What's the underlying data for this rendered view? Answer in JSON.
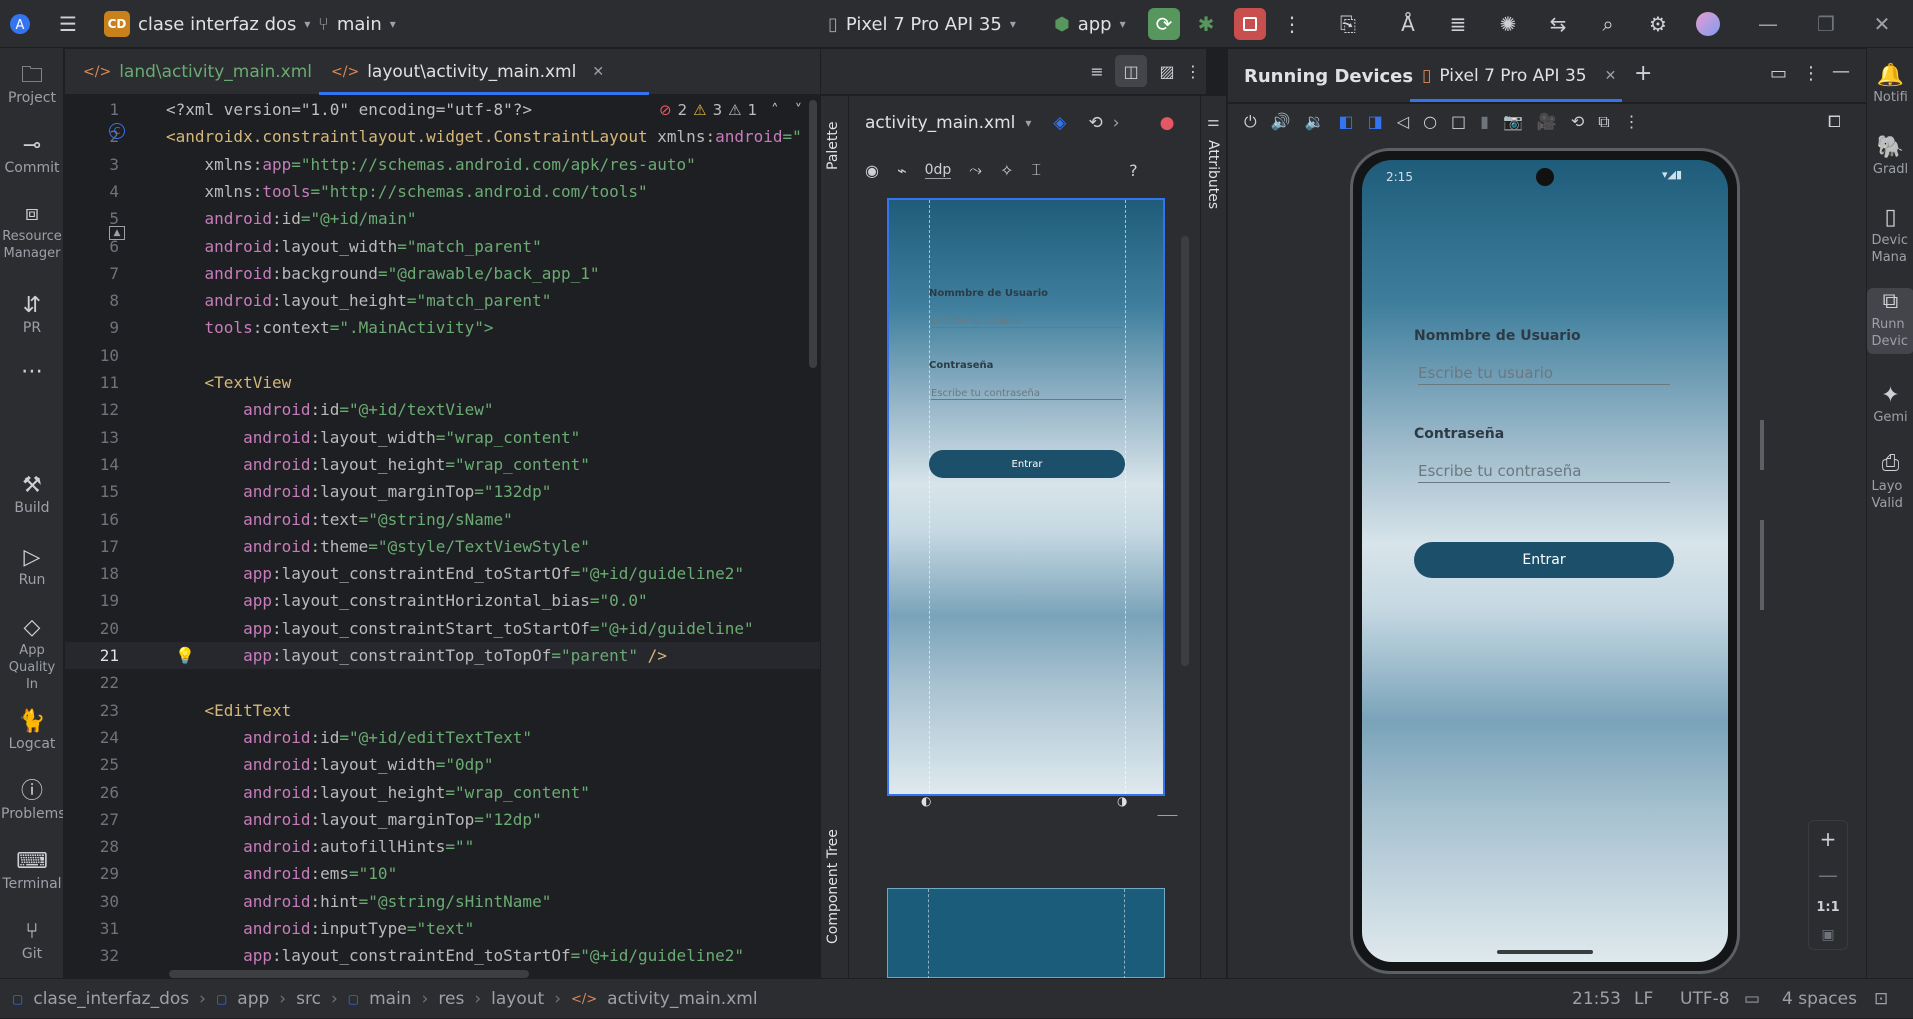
{
  "titlebar": {
    "project_badge": "CD",
    "project_name": "clase interfaz dos",
    "branch": "main",
    "device": "Pixel 7 Pro API 35",
    "run_config": "app"
  },
  "left_tools": [
    {
      "label": "Project",
      "icon": "folder-icon"
    },
    {
      "label": "Commit",
      "icon": "commit-icon"
    },
    {
      "label": "Resource Manager",
      "icon": "resource-manager-icon"
    },
    {
      "label": "PR",
      "icon": "pull-request-icon"
    },
    {
      "label": "Build",
      "icon": "hammer-icon"
    },
    {
      "label": "Run",
      "icon": "run-icon"
    },
    {
      "label": "App Quality In",
      "icon": "app-quality-icon"
    },
    {
      "label": "Logcat",
      "icon": "logcat-icon"
    },
    {
      "label": "Problems",
      "icon": "problems-icon"
    },
    {
      "label": "Terminal",
      "icon": "terminal-icon"
    },
    {
      "label": "Git",
      "icon": "git-icon"
    }
  ],
  "right_tools": [
    {
      "label": "Notifi",
      "icon": "bell-icon"
    },
    {
      "label": "Gradl",
      "icon": "gradle-icon"
    },
    {
      "label": "Devic Mana",
      "icon": "device-manager-icon"
    },
    {
      "label": "Runn Devic",
      "icon": "running-devices-icon"
    },
    {
      "label": "Gemi",
      "icon": "gemini-icon"
    },
    {
      "label": "Layo Valid",
      "icon": "layout-validation-icon"
    }
  ],
  "editor_tabs": [
    {
      "label": "land\\activity_main.xml",
      "active": false
    },
    {
      "label": "layout\\activity_main.xml",
      "active": true
    }
  ],
  "inspection": {
    "errors": "2",
    "warnings": "3",
    "weak": "1"
  },
  "code_lines": [
    {
      "n": "1",
      "segments": [
        {
          "t": "<?xml version=\"1.0\" encoding=\"utf-8\"?>",
          "c": "pi"
        }
      ]
    },
    {
      "n": "2",
      "segments": [
        {
          "t": "<androidx.constraintlayout.widget.ConstraintLayout ",
          "c": "tag"
        },
        {
          "t": "xmlns:",
          "c": "attr"
        },
        {
          "t": "android",
          "c": "attrns"
        },
        {
          "t": "=\"",
          "c": "val"
        }
      ]
    },
    {
      "n": "3",
      "segments": [
        {
          "t": "    xmlns:",
          "c": "attr"
        },
        {
          "t": "app",
          "c": "attrns"
        },
        {
          "t": "=\"http://schemas.android.com/apk/res-auto\"",
          "c": "val"
        }
      ]
    },
    {
      "n": "4",
      "segments": [
        {
          "t": "    xmlns:",
          "c": "attr"
        },
        {
          "t": "tools",
          "c": "attrns"
        },
        {
          "t": "=\"http://schemas.android.com/tools\"",
          "c": "val"
        }
      ]
    },
    {
      "n": "5",
      "segments": [
        {
          "t": "    android",
          "c": "attrns"
        },
        {
          "t": ":id",
          "c": "attr"
        },
        {
          "t": "=\"@+id/main\"",
          "c": "val"
        }
      ]
    },
    {
      "n": "6",
      "segments": [
        {
          "t": "    android",
          "c": "attrns"
        },
        {
          "t": ":layout_width",
          "c": "attr"
        },
        {
          "t": "=\"match_parent\"",
          "c": "val"
        }
      ]
    },
    {
      "n": "7",
      "segments": [
        {
          "t": "    android",
          "c": "attrns"
        },
        {
          "t": ":background",
          "c": "attr"
        },
        {
          "t": "=\"@drawable/back_app_1\"",
          "c": "val"
        }
      ]
    },
    {
      "n": "8",
      "segments": [
        {
          "t": "    android",
          "c": "attrns"
        },
        {
          "t": ":layout_height",
          "c": "attr"
        },
        {
          "t": "=\"match_parent\"",
          "c": "val"
        }
      ]
    },
    {
      "n": "9",
      "segments": [
        {
          "t": "    tools",
          "c": "attrns"
        },
        {
          "t": ":context",
          "c": "attr"
        },
        {
          "t": "=\".MainActivity\">",
          "c": "val"
        }
      ]
    },
    {
      "n": "10",
      "segments": []
    },
    {
      "n": "11",
      "segments": [
        {
          "t": "    <TextView",
          "c": "tag"
        }
      ]
    },
    {
      "n": "12",
      "segments": [
        {
          "t": "        android",
          "c": "attrns"
        },
        {
          "t": ":id",
          "c": "attr"
        },
        {
          "t": "=\"@+id/textView\"",
          "c": "val"
        }
      ]
    },
    {
      "n": "13",
      "segments": [
        {
          "t": "        android",
          "c": "attrns"
        },
        {
          "t": ":layout_width",
          "c": "attr"
        },
        {
          "t": "=\"wrap_content\"",
          "c": "val"
        }
      ]
    },
    {
      "n": "14",
      "segments": [
        {
          "t": "        android",
          "c": "attrns"
        },
        {
          "t": ":layout_height",
          "c": "attr"
        },
        {
          "t": "=\"wrap_content\"",
          "c": "val"
        }
      ]
    },
    {
      "n": "15",
      "segments": [
        {
          "t": "        android",
          "c": "attrns"
        },
        {
          "t": ":layout_marginTop",
          "c": "attr"
        },
        {
          "t": "=\"132dp\"",
          "c": "val"
        }
      ]
    },
    {
      "n": "16",
      "segments": [
        {
          "t": "        android",
          "c": "attrns"
        },
        {
          "t": ":text",
          "c": "attr"
        },
        {
          "t": "=\"@string/sName\"",
          "c": "val"
        }
      ]
    },
    {
      "n": "17",
      "segments": [
        {
          "t": "        android",
          "c": "attrns"
        },
        {
          "t": ":theme",
          "c": "attr"
        },
        {
          "t": "=\"@style/TextViewStyle\"",
          "c": "val"
        }
      ]
    },
    {
      "n": "18",
      "segments": [
        {
          "t": "        app",
          "c": "attrns"
        },
        {
          "t": ":layout_constraintEnd_toStartOf",
          "c": "attr"
        },
        {
          "t": "=\"@+id/guideline2\"",
          "c": "val"
        }
      ]
    },
    {
      "n": "19",
      "segments": [
        {
          "t": "        app",
          "c": "attrns"
        },
        {
          "t": ":layout_constraintHorizontal_bias",
          "c": "attr"
        },
        {
          "t": "=\"0.0\"",
          "c": "val"
        }
      ]
    },
    {
      "n": "20",
      "segments": [
        {
          "t": "        app",
          "c": "attrns"
        },
        {
          "t": ":layout_constraintStart_toStartOf",
          "c": "attr"
        },
        {
          "t": "=\"@+id/guideline\"",
          "c": "val"
        }
      ]
    },
    {
      "n": "21",
      "segments": [
        {
          "t": "        app",
          "c": "attrns"
        },
        {
          "t": ":layout_constraintTop_toTopOf",
          "c": "attr"
        },
        {
          "t": "=\"parent\" ",
          "c": "val"
        },
        {
          "t": "/>",
          "c": "tag"
        }
      ]
    },
    {
      "n": "22",
      "segments": []
    },
    {
      "n": "23",
      "segments": [
        {
          "t": "    <EditText",
          "c": "tag"
        }
      ]
    },
    {
      "n": "24",
      "segments": [
        {
          "t": "        android",
          "c": "attrns"
        },
        {
          "t": ":id",
          "c": "attr"
        },
        {
          "t": "=\"@+id/editTextText\"",
          "c": "val"
        }
      ]
    },
    {
      "n": "25",
      "segments": [
        {
          "t": "        android",
          "c": "attrns"
        },
        {
          "t": ":layout_width",
          "c": "attr"
        },
        {
          "t": "=\"0dp\"",
          "c": "val"
        }
      ]
    },
    {
      "n": "26",
      "segments": [
        {
          "t": "        android",
          "c": "attrns"
        },
        {
          "t": ":layout_height",
          "c": "attr"
        },
        {
          "t": "=\"wrap_content\"",
          "c": "val"
        }
      ]
    },
    {
      "n": "27",
      "segments": [
        {
          "t": "        android",
          "c": "attrns"
        },
        {
          "t": ":layout_marginTop",
          "c": "attr"
        },
        {
          "t": "=\"12dp\"",
          "c": "val"
        }
      ]
    },
    {
      "n": "28",
      "segments": [
        {
          "t": "        android",
          "c": "attrns"
        },
        {
          "t": ":autofillHints",
          "c": "attr"
        },
        {
          "t": "=\"\"",
          "c": "val"
        }
      ]
    },
    {
      "n": "29",
      "segments": [
        {
          "t": "        android",
          "c": "attrns"
        },
        {
          "t": ":ems",
          "c": "attr"
        },
        {
          "t": "=\"10\"",
          "c": "val"
        }
      ]
    },
    {
      "n": "30",
      "segments": [
        {
          "t": "        android",
          "c": "attrns"
        },
        {
          "t": ":hint",
          "c": "attr"
        },
        {
          "t": "=\"@string/sHintName\"",
          "c": "val"
        }
      ]
    },
    {
      "n": "31",
      "segments": [
        {
          "t": "        android",
          "c": "attrns"
        },
        {
          "t": ":inputType",
          "c": "attr"
        },
        {
          "t": "=\"text\"",
          "c": "val"
        }
      ]
    },
    {
      "n": "32",
      "segments": [
        {
          "t": "        app",
          "c": "attrns"
        },
        {
          "t": ":layout_constraintEnd_toStartOf",
          "c": "attr"
        },
        {
          "t": "=\"@+id/guideline2\"",
          "c": "val"
        }
      ]
    }
  ],
  "current_line": "21",
  "design": {
    "file_select": "activity_main.xml",
    "margin_value": "0dp",
    "palette_label": "Palette",
    "component_tree_label": "Component Tree",
    "attributes_label": "Attributes"
  },
  "app_screen": {
    "user_label": "Nommbre de Usuario",
    "user_hint": "Escribe tu usuario",
    "pass_label": "Contraseña",
    "pass_hint": "Escribe tu contraseña",
    "button_label": "Entrar",
    "status_time": "2:15"
  },
  "running_devices": {
    "title": "Running Devices",
    "device_tab": "Pixel 7 Pro API 35",
    "zoom_label": "1:1"
  },
  "statusbar": {
    "breadcrumb": [
      "clase_interfaz_dos",
      "app",
      "src",
      "main",
      "res",
      "layout",
      "activity_main.xml"
    ],
    "position": "21:53",
    "line_sep": "LF",
    "encoding": "UTF-8",
    "indent": "4 spaces"
  },
  "colors": {
    "accent_green": "#57965c",
    "stop_red": "#c94f4f",
    "error_red": "#e55765",
    "warning_yellow": "#e5b93e",
    "button_teal": "#1b4f6a"
  }
}
